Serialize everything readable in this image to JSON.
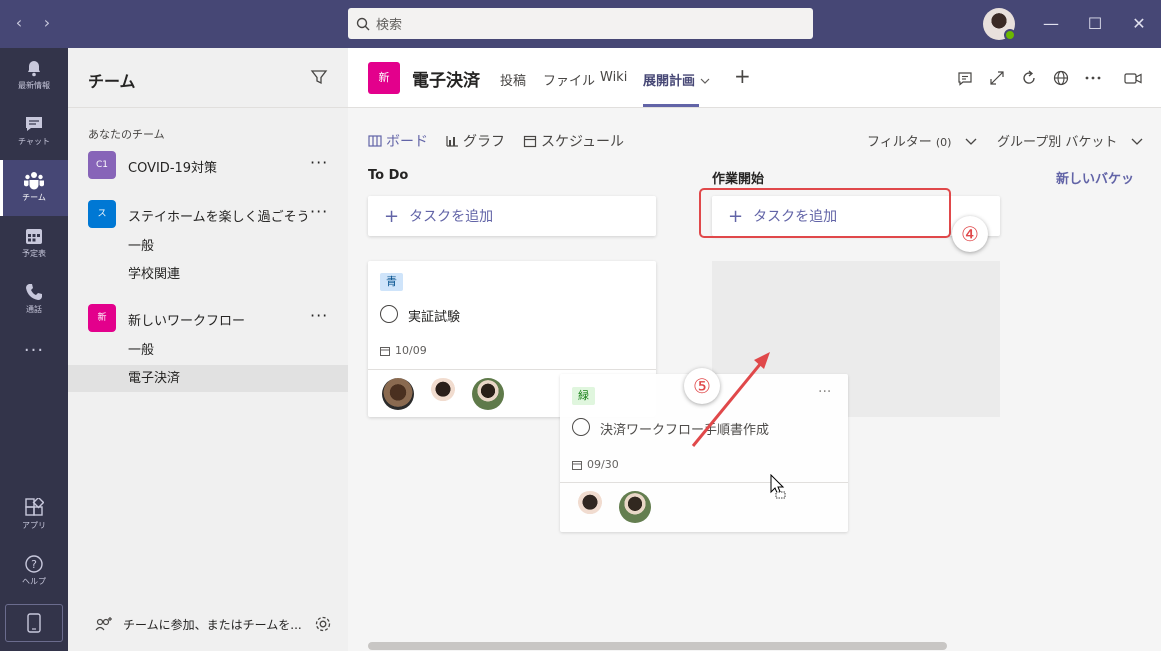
{
  "titlebar": {
    "search_placeholder": "検索",
    "back": "‹",
    "forward": "›",
    "minimize": "—",
    "maximize": "☐",
    "close": "✕"
  },
  "rail": {
    "items": [
      {
        "label": "最新情報",
        "icon": "bell-icon"
      },
      {
        "label": "チャット",
        "icon": "chat-icon"
      },
      {
        "label": "チーム",
        "icon": "teams-icon"
      },
      {
        "label": "予定表",
        "icon": "calendar-icon"
      },
      {
        "label": "通話",
        "icon": "phone-icon"
      },
      {
        "label": "アプリ",
        "icon": "apps-icon"
      },
      {
        "label": "ヘルプ",
        "icon": "help-icon"
      }
    ],
    "more": "···"
  },
  "teams_panel": {
    "title": "チーム",
    "section": "あなたのチーム",
    "teams": [
      {
        "tile": "C1",
        "name": "COVID-19対策",
        "color": "#8764b8"
      },
      {
        "tile": "ス",
        "name": "ステイホームを楽しく過ごそう",
        "color": "#0078d4",
        "channels": [
          "一般",
          "学校関連"
        ]
      },
      {
        "tile": "新",
        "name": "新しいワークフロー",
        "color": "#e3008c",
        "channels": [
          "一般",
          "電子決済"
        ]
      }
    ],
    "more": "···",
    "footer": "チームに参加、またはチームを..."
  },
  "header": {
    "tile": "新",
    "title": "電子決済",
    "tabs": [
      "投稿",
      "ファイル",
      "Wiki",
      "展開計画"
    ],
    "add_tab": "+"
  },
  "planner": {
    "views": [
      "ボード",
      "グラフ",
      "スケジュール"
    ],
    "filter": "フィルター",
    "filter_count": "(0)",
    "group_by": "グループ別 バケット",
    "new_bucket": "新しいバケッ",
    "buckets": [
      {
        "title": "To Do",
        "add_task": "タスクを追加"
      },
      {
        "title": "作業開始",
        "add_task": "タスクを追加"
      }
    ],
    "cards": [
      {
        "tag": "青",
        "tag_color": "#cfe4fa",
        "name": "実証試験",
        "due": "10/09"
      },
      {
        "tag": "緑",
        "tag_color": "#dff6dd",
        "name": "決済ワークフロー手順書作成",
        "due": "09/30",
        "more": "···"
      }
    ],
    "callouts": [
      "④",
      "⑤"
    ]
  },
  "colors": {
    "titlebar": "#464775",
    "rail": "#33344a",
    "accent": "#6264a7",
    "annotation": "#e0484a"
  }
}
